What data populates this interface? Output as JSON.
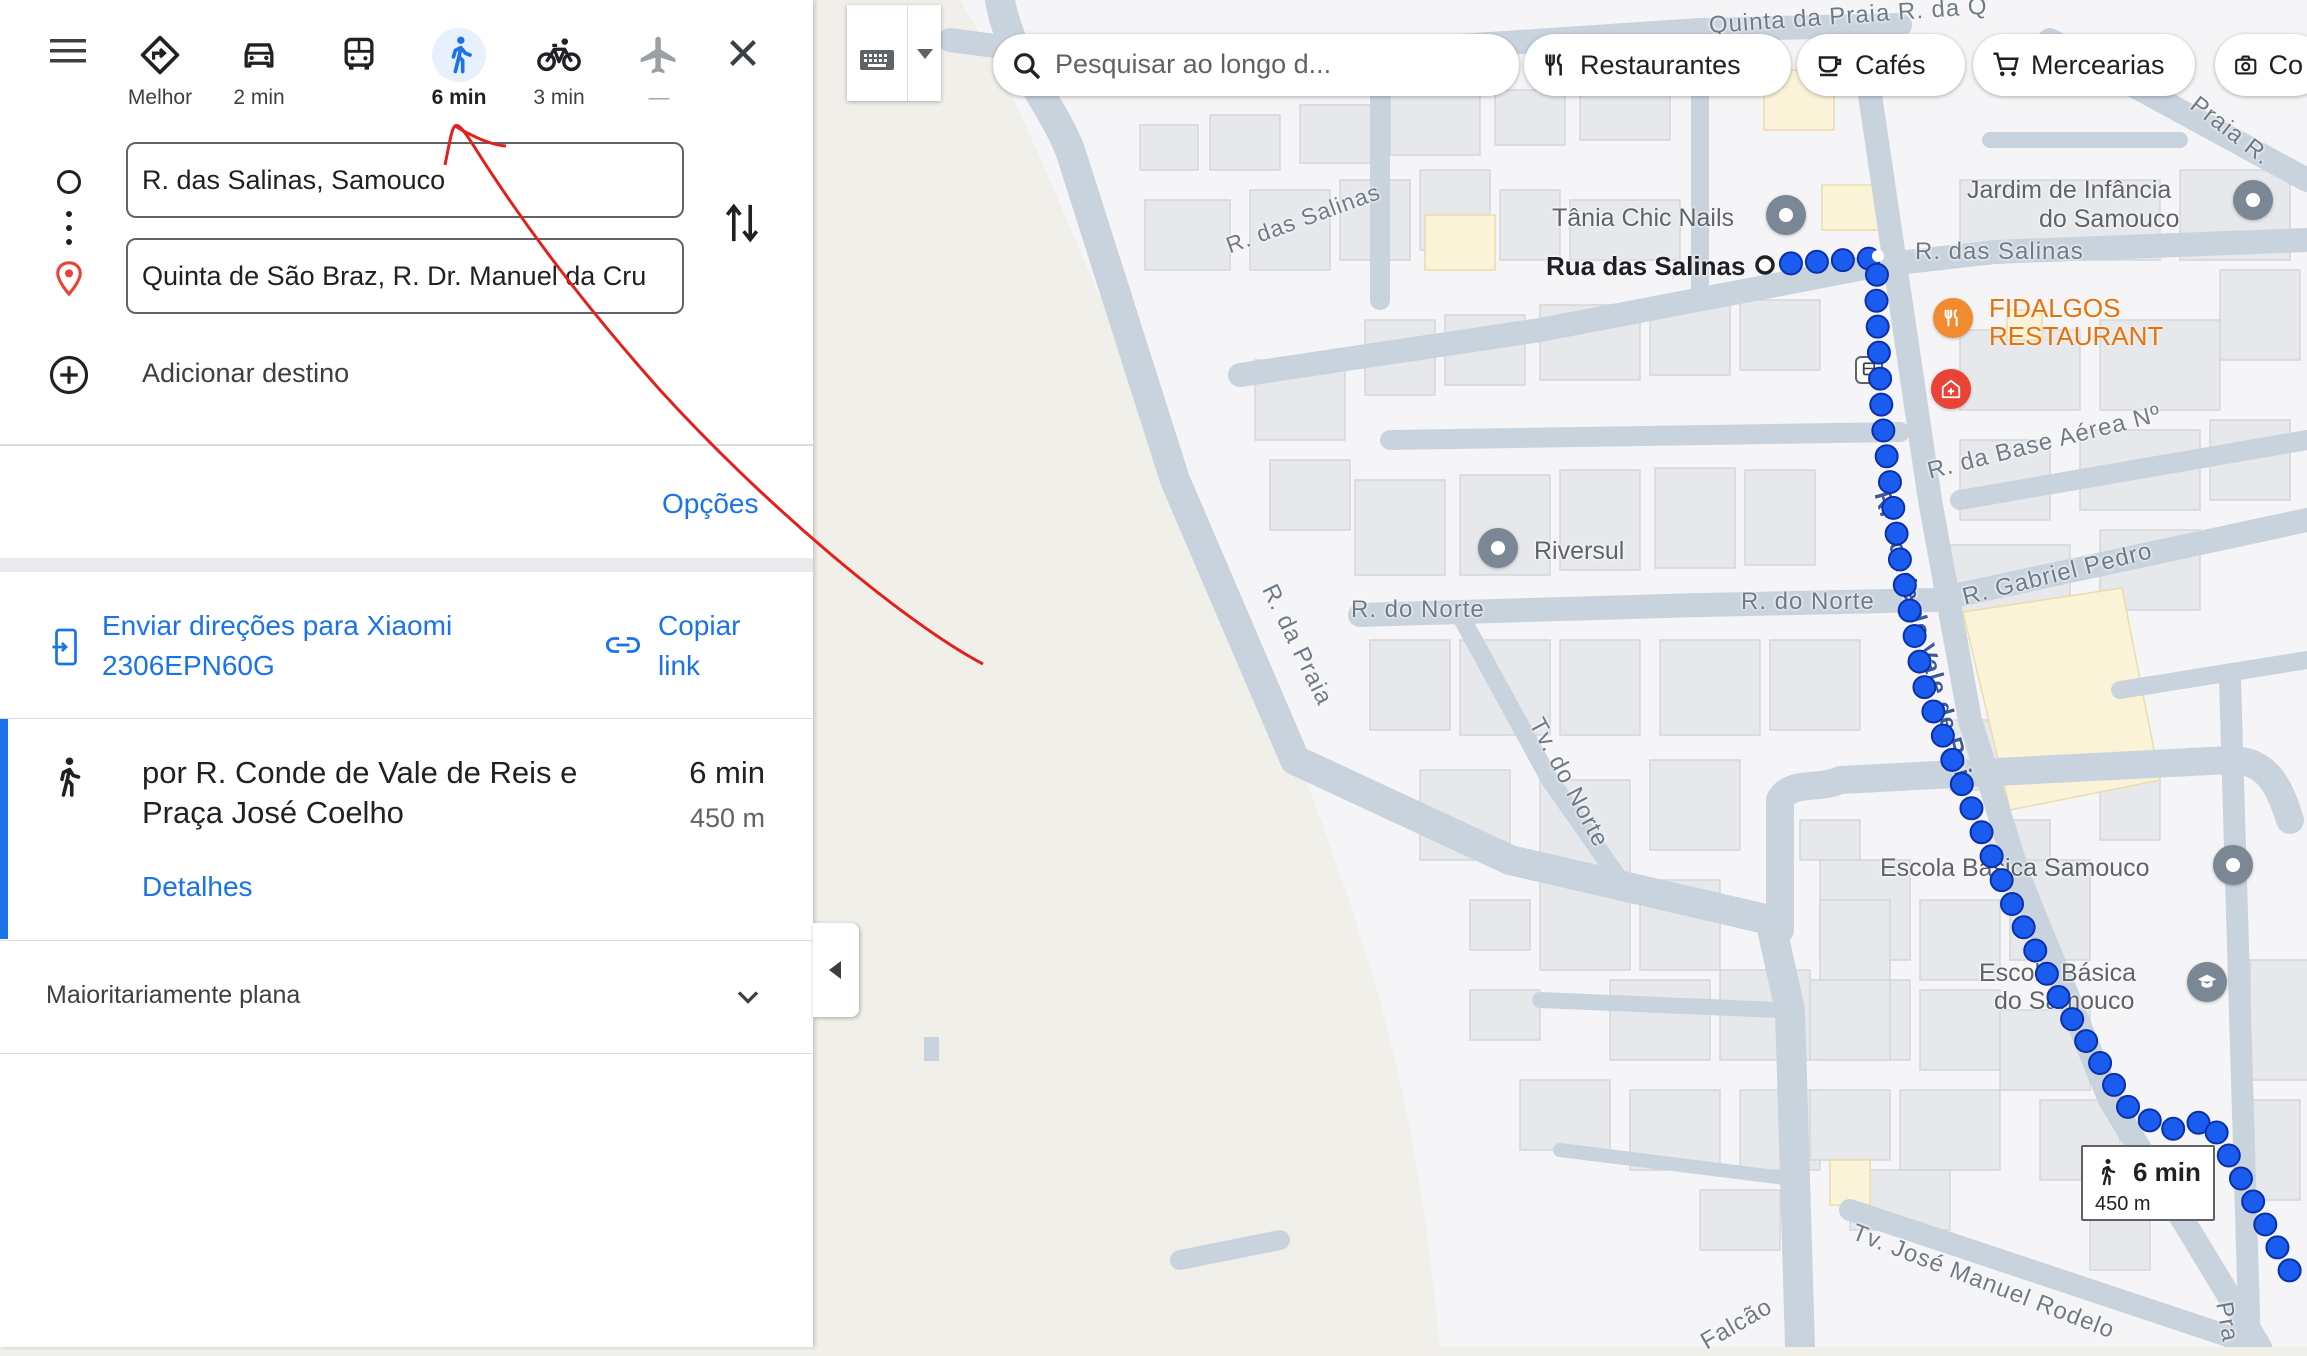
{
  "travel_modes": [
    {
      "name": "best",
      "label": "Melhor"
    },
    {
      "name": "car",
      "label": "2 min"
    },
    {
      "name": "transit",
      "label": ""
    },
    {
      "name": "walk",
      "label": "6 min"
    },
    {
      "name": "bike",
      "label": "3 min"
    },
    {
      "name": "flight",
      "label": "—"
    }
  ],
  "origin": {
    "value": "R. das Salinas, Samouco"
  },
  "destination": {
    "value": "Quinta de São Braz, R. Dr. Manuel da Cru"
  },
  "add_destination": "Adicionar destino",
  "options_link": "Opções",
  "send_directions": {
    "line1": "Enviar direções para Xiaomi",
    "line2": "2306EPN60G"
  },
  "copy_link": {
    "line1": "Copiar",
    "line2": "link"
  },
  "route": {
    "via_line1": "por R. Conde de Vale de Reis e",
    "via_line2": "Praça José Coelho",
    "duration": "6 min",
    "distance": "450 m",
    "details": "Detalhes"
  },
  "elevation": "Maioritariamente plana",
  "map": {
    "search_placeholder": "Pesquisar ao longo d...",
    "chips": [
      "Restaurantes",
      "Cafés",
      "Mercearias",
      "Co"
    ],
    "pois": {
      "tania": "Tânia Chic Nails",
      "rua_salinas": "Rua das Salinas",
      "jardim1": "Jardim de Infância",
      "jardim2": "do Samouco",
      "fidalgos1": "FIDALGOS",
      "fidalgos2": "RESTAURANT",
      "riversul": "Riversul",
      "escola1": "Escola Básica Samouco",
      "escola2a": "Escola Básica",
      "escola2b": "do Samouco"
    },
    "streets": {
      "s1": "R. das Salinas",
      "s2": "R. das Salinas",
      "s3": "R. da Base Aérea Nº",
      "s4": "R. Gabriel Pedro",
      "s5": "R. do Norte",
      "s6": "R. do Norte",
      "s7": "R. da Praia",
      "s8": "Tv. do Norte",
      "s9": "R. Conde de Vale de Reis",
      "s10": "Tv. José Manuel Rodelo",
      "s11": "Falcão",
      "s12": "Quinta da Praia R. da Q",
      "s13": "Praia R.",
      "s14": "Pra"
    },
    "route_badge": {
      "duration": "6 min",
      "distance": "450 m"
    }
  },
  "colors": {
    "accent": "#1a73e8",
    "route": "#1a5cf0",
    "annotation": "#e3201b"
  }
}
